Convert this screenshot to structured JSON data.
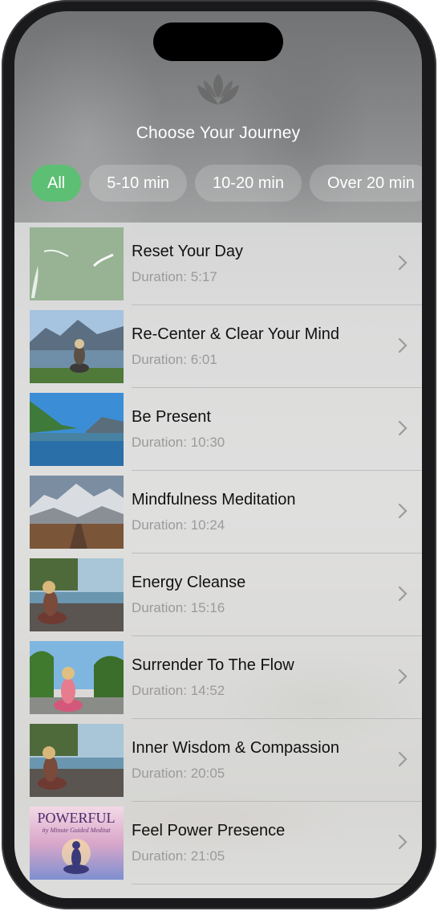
{
  "header": {
    "title": "Choose Your Journey",
    "logo_icon": "lotus-icon"
  },
  "filters": [
    {
      "label": "All",
      "active": true
    },
    {
      "label": "5-10 min",
      "active": false
    },
    {
      "label": "10-20 min",
      "active": false
    },
    {
      "label": "Over 20 min",
      "active": false
    }
  ],
  "meditations": [
    {
      "title": "Reset Your Day",
      "duration": "Duration: 5:17",
      "thumb": "green-mist"
    },
    {
      "title": "Re-Center & Clear Your Mind",
      "duration": "Duration: 6:01",
      "thumb": "mountain-lake-woman"
    },
    {
      "title": "Be Present",
      "duration": "Duration: 10:30",
      "thumb": "blue-lake-valley"
    },
    {
      "title": "Mindfulness Meditation",
      "duration": "Duration: 10:24",
      "thumb": "snowy-mountains-road"
    },
    {
      "title": "Energy Cleanse",
      "duration": "Duration: 15:16",
      "thumb": "woman-rocks-coast"
    },
    {
      "title": "Surrender To The Flow",
      "duration": "Duration: 14:52",
      "thumb": "woman-palm-trees"
    },
    {
      "title": "Inner Wisdom & Compassion",
      "duration": "Duration: 20:05",
      "thumb": "woman-rocks-coast-2"
    },
    {
      "title": "Feel Power Presence",
      "duration": "Duration: 21:05",
      "thumb": "powerful-poster",
      "thumb_text": "POWERFUL",
      "thumb_subtext": "ity Minute Guided Meditat"
    }
  ],
  "colors": {
    "active_chip": "#5cbf74",
    "title_text": "#111111",
    "subtitle_text": "#9a9a9a"
  }
}
